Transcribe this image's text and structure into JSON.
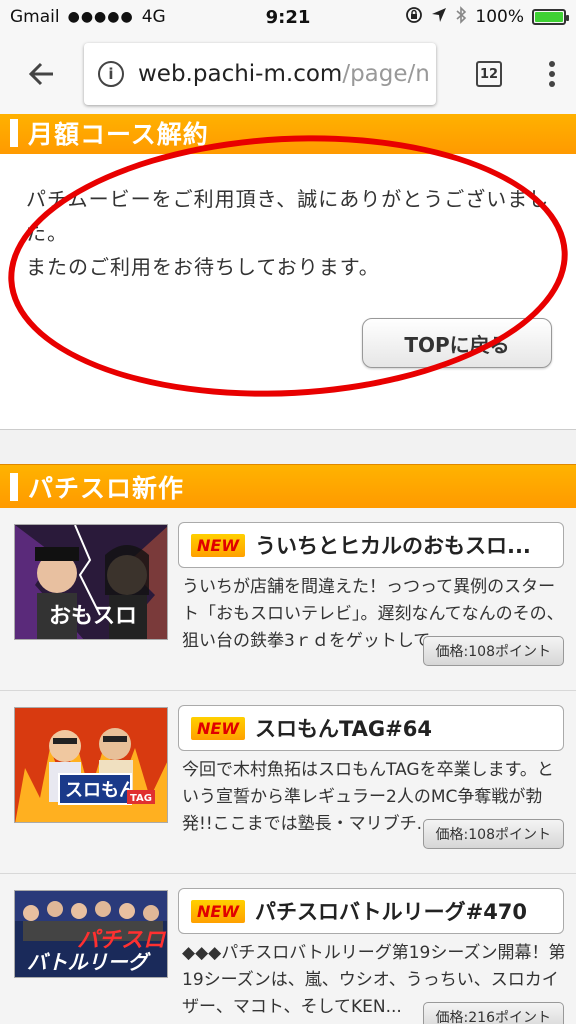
{
  "status": {
    "carrier": "Gmail",
    "signal": "●●●●●",
    "network": "4G",
    "time": "9:21",
    "battery": "100%",
    "battery_level": 1.0,
    "battery_color": "#3fd134"
  },
  "browser": {
    "url_host": "web.pachi-m.com",
    "url_path": "/page/n",
    "tab_count": "12"
  },
  "cancel_section": {
    "title": "月額コース解約",
    "message_line1": "パチムービーをご利用頂き、誠にありがとうございました。",
    "message_line2": "またのご利用をお待ちしております。",
    "top_button": "TOPに戻る"
  },
  "new_section": {
    "title": "パチスロ新作"
  },
  "items": [
    {
      "badge": "NEW",
      "title": "ういちとヒカルのおもスロ...",
      "desc": "ういちが店舗を間違えた！っつって異例のスタート「おもスロいテレビ」。遅刻なんてなんのその、狙い台の鉄拳3ｒｄをゲットして...",
      "price": "価格:108ポイント"
    },
    {
      "badge": "NEW",
      "title": "スロもんTAG#64",
      "desc": "今回で木村魚拓はスロもんTAGを卒業します。という宣誓から準レギュラー2人のMC争奪戦が勃発!!ここまでは塾長・マリブチ...",
      "price": "価格:108ポイント"
    },
    {
      "badge": "NEW",
      "title": "パチスロバトルリーグ#470",
      "desc": "◆◆◆パチスロバトルリーグ第19シーズン開幕！第19シーズンは、嵐、ウシオ、うっちい、スロカイザー、マコト、そしてKEN...",
      "price": "価格:216ポイント"
    }
  ]
}
